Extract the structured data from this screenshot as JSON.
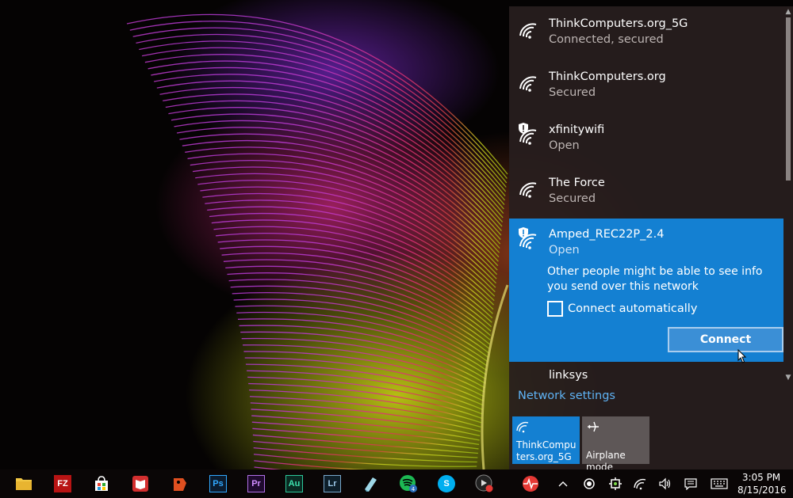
{
  "colors": {
    "flyout_bg": "#281e1e",
    "accent": "#1480d2",
    "link": "#5fb3f5",
    "taskbar_bg": "#0a0606"
  },
  "wifi_flyout": {
    "networks": [
      {
        "ssid": "ThinkComputers.org_5G",
        "status": "Connected, secured",
        "icon": "wifi-secured-icon"
      },
      {
        "ssid": "ThinkComputers.org",
        "status": "Secured",
        "icon": "wifi-secured-icon"
      },
      {
        "ssid": "xfinitywifi",
        "status": "Open",
        "icon": "wifi-open-warning-icon"
      },
      {
        "ssid": "The Force",
        "status": "Secured",
        "icon": "wifi-secured-icon"
      }
    ],
    "selected_network": {
      "ssid": "Amped_REC22P_2.4",
      "status": "Open",
      "warning": "Other people might be able to see info you send over this network",
      "connect_auto_label": "Connect automatically",
      "connect_auto_checked": false,
      "connect_button": "Connect"
    },
    "partial_network": {
      "ssid": "linksys"
    },
    "network_settings_link": "Network settings",
    "quick_actions": [
      {
        "label": "ThinkComputers.org_5G",
        "icon": "wifi-icon",
        "active": true
      },
      {
        "label": "Airplane mode",
        "icon": "airplane-icon",
        "active": false
      }
    ]
  },
  "taskbar": {
    "apps": [
      {
        "name": "file-explorer",
        "icon": "folder-icon"
      },
      {
        "name": "filezilla",
        "icon": "filezilla-icon",
        "text": "FZ"
      },
      {
        "name": "store",
        "icon": "store-icon"
      },
      {
        "name": "reader",
        "icon": "book-icon"
      },
      {
        "name": "app-red",
        "icon": "red-app-icon"
      },
      {
        "name": "photoshop",
        "icon": "photoshop-icon",
        "text": "Ps"
      },
      {
        "name": "premiere",
        "icon": "premiere-icon",
        "text": "Pr"
      },
      {
        "name": "audition",
        "icon": "audition-icon",
        "text": "Au"
      },
      {
        "name": "lightroom",
        "icon": "lightroom-icon",
        "text": "Lr"
      },
      {
        "name": "app-glass",
        "icon": "glass-icon"
      },
      {
        "name": "spotify",
        "icon": "spotify-icon",
        "badge": "4"
      },
      {
        "name": "skype",
        "icon": "skype-icon",
        "text": "S"
      },
      {
        "name": "app-record",
        "icon": "record-icon"
      },
      {
        "name": "monitor",
        "icon": "pulse-icon"
      }
    ],
    "tray": [
      "chevron-up-icon",
      "circle-icon",
      "settings-icon",
      "wifi-icon",
      "volume-icon",
      "notification-icon",
      "keyboard-icon"
    ],
    "clock": {
      "time": "3:05 PM",
      "date": "8/15/2016"
    }
  }
}
